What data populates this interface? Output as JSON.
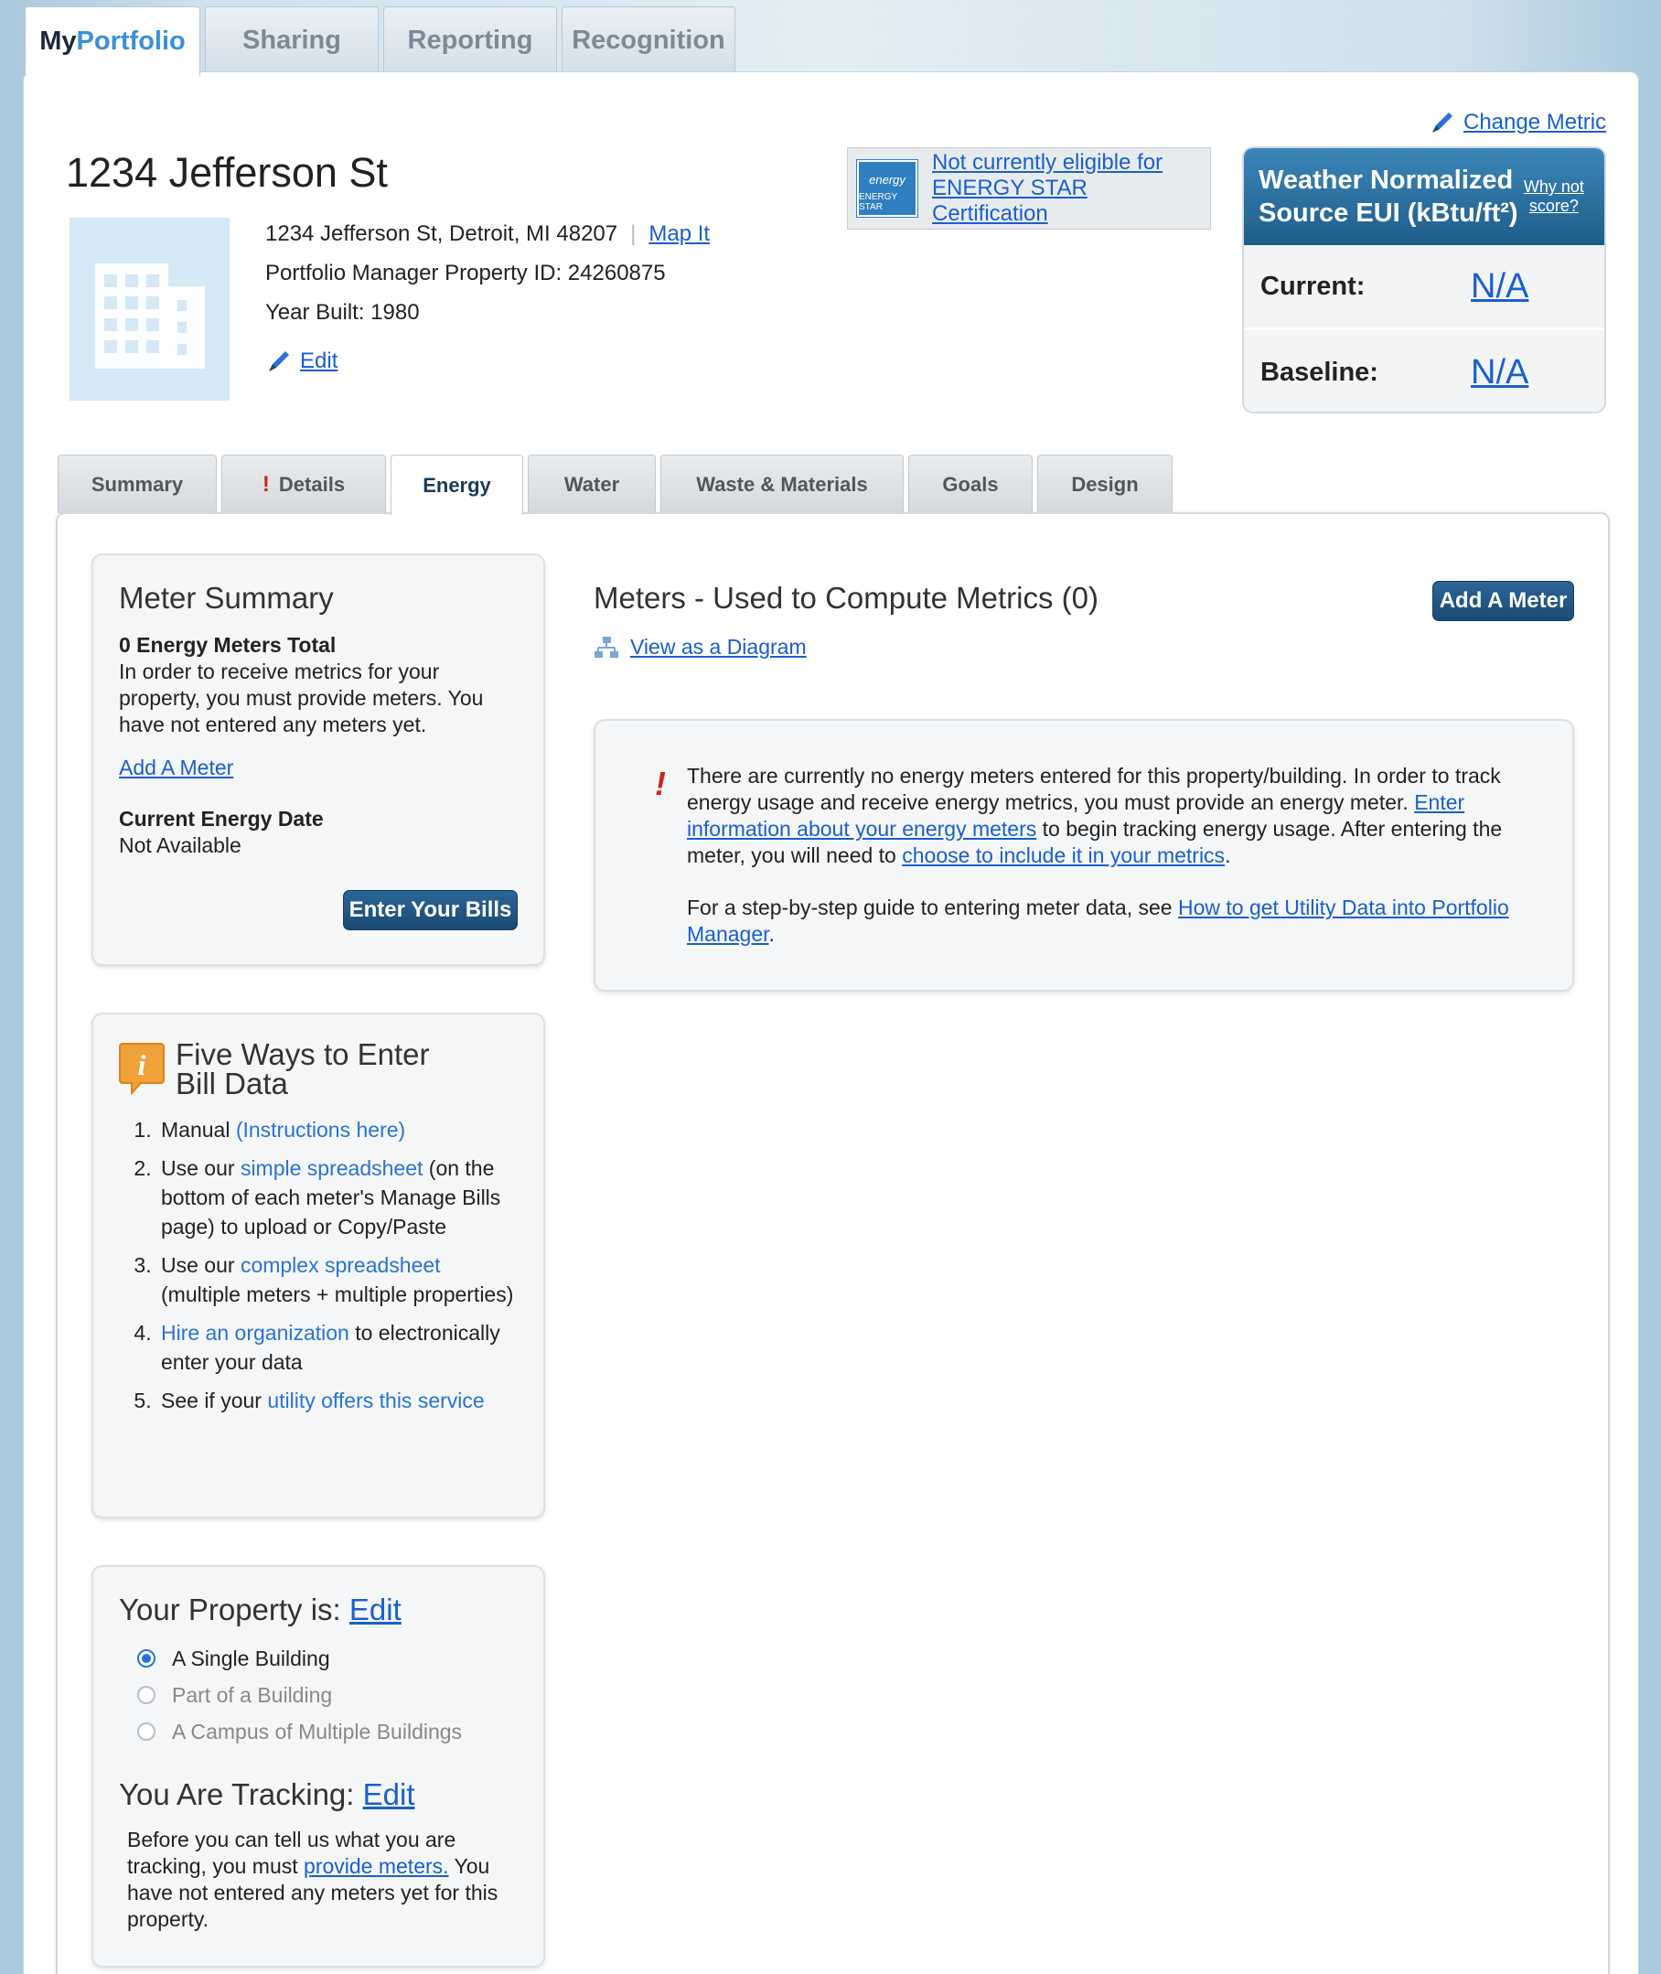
{
  "top_tabs": {
    "my": "My",
    "portfolio": "Portfolio",
    "sharing": "Sharing",
    "reporting": "Reporting",
    "recognition": "Recognition"
  },
  "property": {
    "name": "1234 Jefferson St",
    "address": "1234 Jefferson St, Detroit, MI 48207",
    "map_link": "Map It",
    "pm_id": "Portfolio Manager Property ID: 24260875",
    "year_built": "Year Built: 1980",
    "edit": "Edit"
  },
  "energy_star": {
    "logo_text": "ENERGY STAR",
    "logo_script": "energy",
    "message": "Not currently eligible for ENERGY STAR Certification"
  },
  "metric": {
    "change_link": "Change Metric",
    "title": "Weather Normalized Source EUI (kBtu/ft²)",
    "why_not": "Why not score?",
    "current_label": "Current:",
    "current_value": "N/A",
    "baseline_label": "Baseline:",
    "baseline_value": "N/A"
  },
  "sub_tabs": [
    "Summary",
    "Details",
    "Energy",
    "Water",
    "Waste & Materials",
    "Goals",
    "Design"
  ],
  "meter_summary": {
    "title": "Meter Summary",
    "count": "0 Energy Meters Total",
    "text": "In order to receive metrics for your property, you must provide meters. You have not entered any meters yet.",
    "add_link": "Add A Meter",
    "date_label": "Current Energy Date",
    "date_value": "Not Available",
    "bills_button": "Enter Your Bills"
  },
  "five_ways": {
    "title_line1": "Five Ways to Enter",
    "title_line2": "Bill Data",
    "items": [
      {
        "pre": "Manual ",
        "link": "(Instructions here)",
        "post": ""
      },
      {
        "pre": "Use our ",
        "link": "simple spreadsheet",
        "post": " (on the bottom of each meter's Manage Bills page) to upload or Copy/Paste"
      },
      {
        "pre": "Use our ",
        "link": "complex spreadsheet",
        "post": " (multiple meters + multiple properties)"
      },
      {
        "pre": "",
        "link": "Hire an organization",
        "post": " to electronically enter your data"
      },
      {
        "pre": "See if your ",
        "link": "utility offers this service",
        "post": ""
      }
    ]
  },
  "property_type": {
    "title": "Your Property is:",
    "edit": "Edit",
    "options": [
      "A Single Building",
      "Part of a Building",
      "A Campus of Multiple Buildings"
    ],
    "tracking_title": "You Are Tracking:",
    "tracking_edit": "Edit",
    "tracking_pre": "Before you can tell us what you are tracking, you must ",
    "tracking_link": "provide meters.",
    "tracking_post": " You have not entered any meters yet for this property."
  },
  "meters": {
    "title": "Meters - Used to Compute Metrics (0)",
    "add_button": "Add A Meter",
    "diagram_link": "View as a Diagram",
    "notice_1": "There are currently no energy meters entered for this property/building. In order to track energy usage and receive energy metrics, you must provide an energy meter. ",
    "notice_link1": "Enter information about your energy meters",
    "notice_2": " to begin tracking energy usage. After entering the meter, you will need to ",
    "notice_link2": "choose to include it in your metrics",
    "notice_3": ".",
    "guide_pre": "For a step-by-step guide to entering meter data, see ",
    "guide_link": "How to get Utility Data into Portfolio Manager",
    "guide_post": "."
  }
}
